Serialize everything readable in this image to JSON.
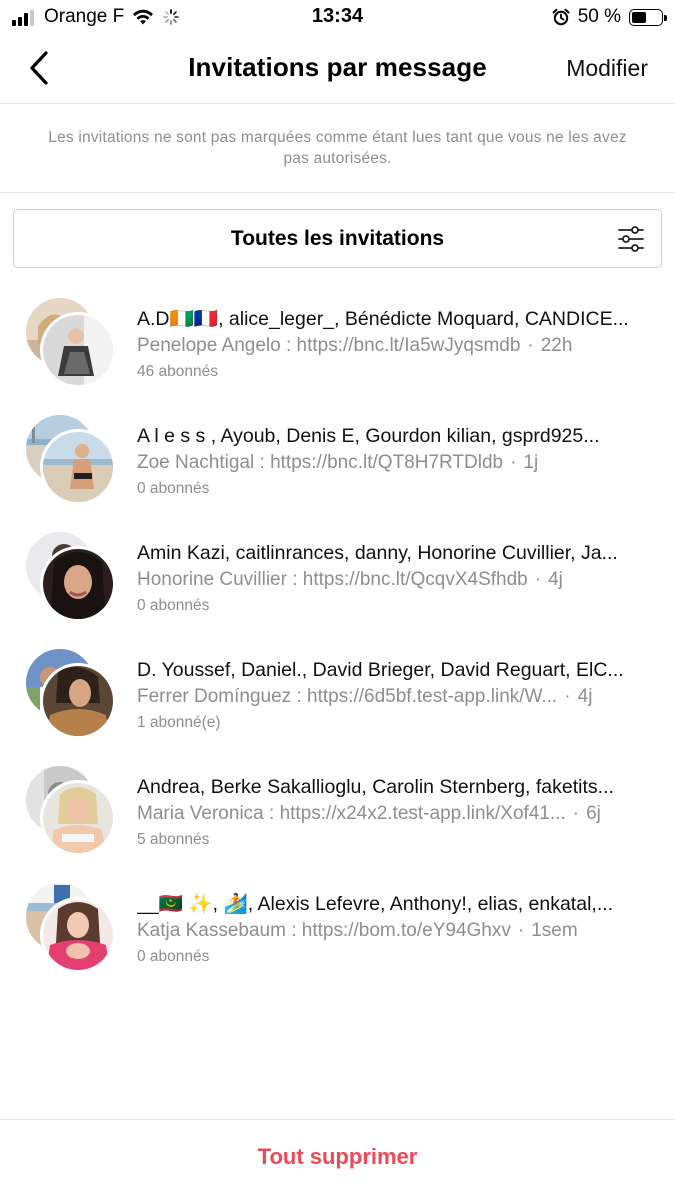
{
  "status_bar": {
    "carrier": "Orange F",
    "time": "13:34",
    "battery_text": "50 %",
    "battery_level": 0.5,
    "icons": [
      "signal-icon",
      "wifi-icon",
      "loading-icon",
      "alarm-icon",
      "battery-icon"
    ]
  },
  "header": {
    "back_icon": "chevron-left-icon",
    "title": "Invitations par message",
    "edit_label": "Modifier"
  },
  "info_text": "Les invitations ne sont pas marquées comme étant lues tant que vous ne les avez pas autorisées.",
  "filter": {
    "label": "Toutes les invitations",
    "icon": "sliders-icon"
  },
  "requests": [
    {
      "names": "A.D🇨🇮🇫🇷, alice_leger_, Bénédicte Moquard, CANDICE...",
      "message": "Penelope Angelo : https://bnc.lt/Ia5wJyqsmdb",
      "time": "22h",
      "followers": "46 abonnés"
    },
    {
      "names": "A l e s s , Ayoub, Denis E, Gourdon kilian, gsprd925...",
      "message": "Zoe Nachtigal : https://bnc.lt/QT8H7RTDldb",
      "time": "1j",
      "followers": "0 abonnés"
    },
    {
      "names": "Amin Kazi, caitlinrances, danny, Honorine Cuvillier, Ja...",
      "message": "Honorine Cuvillier : https://bnc.lt/QcqvX4Sfhdb",
      "time": "4j",
      "followers": "0 abonnés"
    },
    {
      "names": "D. Youssef, Daniel., David Brieger, David Reguart, ElC...",
      "message": "Ferrer Domínguez : https://6d5bf.test-app.link/W...",
      "time": "4j",
      "followers": "1 abonné(e)"
    },
    {
      "names": "Andrea, Berke Sakallioglu, Carolin Sternberg, faketits...",
      "message": "Maria Veronica : https://x24x2.test-app.link/Xof41...",
      "time": "6j",
      "followers": "5 abonnés"
    },
    {
      "names": "__🇲🇷 ✨, 🏄, Alexis Lefevre, Anthony!, elias, enkatal,...",
      "message": "Katja Kassebaum : https://bom.to/eY94Ghxv",
      "time": "1sem",
      "followers": "0 abonnés"
    }
  ],
  "footer": {
    "delete_all_label": "Tout supprimer",
    "delete_color": "#ed4956"
  }
}
